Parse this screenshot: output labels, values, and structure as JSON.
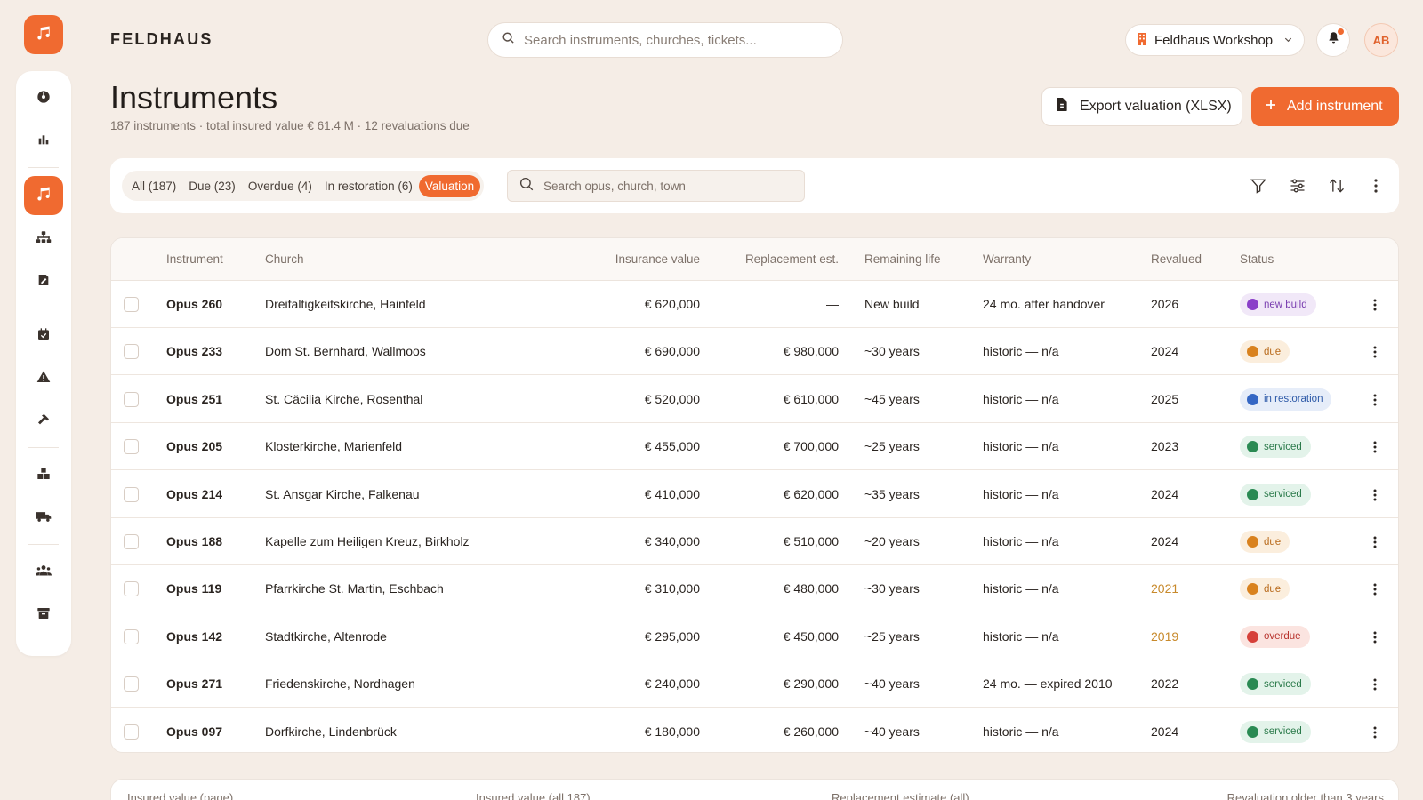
{
  "brand": "FELDHAUS",
  "search": {
    "placeholder": "Search instruments, churches, tickets..."
  },
  "workspace": {
    "label": "Feldhaus Workshop"
  },
  "user": {
    "initials": "AB"
  },
  "sidebar": {
    "items": [
      {
        "icon": "dashboard-icon"
      },
      {
        "icon": "bar-chart-icon"
      },
      {
        "icon": "music-note-icon",
        "active": true
      },
      {
        "icon": "org-chart-icon"
      },
      {
        "icon": "contract-icon"
      },
      {
        "icon": "calendar-icon"
      },
      {
        "icon": "warning-icon"
      },
      {
        "icon": "hammer-icon"
      },
      {
        "icon": "warehouse-icon"
      },
      {
        "icon": "truck-icon"
      },
      {
        "icon": "team-icon"
      },
      {
        "icon": "archive-icon"
      }
    ]
  },
  "page": {
    "title": "Instruments",
    "subtitle": "187 instruments · total insured value € 61.4 M · 12 revaluations due",
    "export_label": "Export valuation (XLSX)",
    "add_label": "Add instrument"
  },
  "filters": [
    {
      "label": "All (187)",
      "active": false
    },
    {
      "label": "Due (23)",
      "active": false
    },
    {
      "label": "Overdue (4)",
      "active": false
    },
    {
      "label": "In restoration (6)",
      "active": false
    },
    {
      "label": "Valuation",
      "active": true
    }
  ],
  "table_search": {
    "placeholder": "Search opus, church, town"
  },
  "table": {
    "headers": {
      "instrument": "Instrument",
      "church": "Church",
      "insurance": "Insurance value",
      "replacement": "Replacement est.",
      "life": "Remaining life",
      "warranty": "Warranty",
      "revalued": "Revalued",
      "status": "Status"
    },
    "rows": [
      {
        "instrument": "Opus 260",
        "church": "Dreifaltigkeitskirche, Hainfeld",
        "insurance": "€ 620,000",
        "replacement": "—",
        "life": "New build",
        "warranty": "24 mo. after handover",
        "revalued": "2026",
        "revalued_warn": false,
        "status": "new build",
        "status_kind": "new"
      },
      {
        "instrument": "Opus 233",
        "church": "Dom St. Bernhard, Wallmoos",
        "insurance": "€ 690,000",
        "replacement": "€ 980,000",
        "life": "~30 years",
        "warranty": "historic — n/a",
        "revalued": "2024",
        "revalued_warn": false,
        "status": "due",
        "status_kind": "due"
      },
      {
        "instrument": "Opus 251",
        "church": "St. Cäcilia Kirche, Rosenthal",
        "insurance": "€ 520,000",
        "replacement": "€ 610,000",
        "life": "~45 years",
        "warranty": "historic — n/a",
        "revalued": "2025",
        "revalued_warn": false,
        "status": "in restoration",
        "status_kind": "restoration"
      },
      {
        "instrument": "Opus 205",
        "church": "Klosterkirche, Marienfeld",
        "insurance": "€ 455,000",
        "replacement": "€ 700,000",
        "life": "~25 years",
        "warranty": "historic — n/a",
        "revalued": "2023",
        "revalued_warn": false,
        "status": "serviced",
        "status_kind": "serviced"
      },
      {
        "instrument": "Opus 214",
        "church": "St. Ansgar Kirche, Falkenau",
        "insurance": "€ 410,000",
        "replacement": "€ 620,000",
        "life": "~35 years",
        "warranty": "historic — n/a",
        "revalued": "2024",
        "revalued_warn": false,
        "status": "serviced",
        "status_kind": "serviced"
      },
      {
        "instrument": "Opus 188",
        "church": "Kapelle zum Heiligen Kreuz, Birkholz",
        "insurance": "€ 340,000",
        "replacement": "€ 510,000",
        "life": "~20 years",
        "warranty": "historic — n/a",
        "revalued": "2024",
        "revalued_warn": false,
        "status": "due",
        "status_kind": "due"
      },
      {
        "instrument": "Opus 119",
        "church": "Pfarrkirche St. Martin, Eschbach",
        "insurance": "€ 310,000",
        "replacement": "€ 480,000",
        "life": "~30 years",
        "warranty": "historic — n/a",
        "revalued": "2021",
        "revalued_warn": true,
        "status": "due",
        "status_kind": "due"
      },
      {
        "instrument": "Opus 142",
        "church": "Stadtkirche, Altenrode",
        "insurance": "€ 295,000",
        "replacement": "€ 450,000",
        "life": "~25 years",
        "warranty": "historic — n/a",
        "revalued": "2019",
        "revalued_warn": true,
        "status": "overdue",
        "status_kind": "overdue"
      },
      {
        "instrument": "Opus 271",
        "church": "Friedenskirche, Nordhagen",
        "insurance": "€ 240,000",
        "replacement": "€ 290,000",
        "life": "~40 years",
        "warranty": "24 mo. — expired 2010",
        "revalued": "2022",
        "revalued_warn": false,
        "status": "serviced",
        "status_kind": "serviced"
      },
      {
        "instrument": "Opus 097",
        "church": "Dorfkirche, Lindenbrück",
        "insurance": "€ 180,000",
        "replacement": "€ 260,000",
        "life": "~40 years",
        "warranty": "historic — n/a",
        "revalued": "2024",
        "revalued_warn": false,
        "status": "serviced",
        "status_kind": "serviced"
      }
    ]
  },
  "status_colors": {
    "new": {
      "bg": "#f1e8f8",
      "dot": "#8a3fc9",
      "text": "#7a3fb0"
    },
    "due": {
      "bg": "#fbeedd",
      "dot": "#d9821e",
      "text": "#b8691a"
    },
    "restoration": {
      "bg": "#e6edf9",
      "dot": "#3567c4",
      "text": "#2e5aa8"
    },
    "serviced": {
      "bg": "#e3f3ea",
      "dot": "#2a8a53",
      "text": "#2a7a4a"
    },
    "overdue": {
      "bg": "#fbe4e0",
      "dot": "#d6403a",
      "text": "#b8342e"
    }
  },
  "summary": {
    "labels": [
      "Insured value (page)",
      "Insured value (all 187)",
      "Replacement estimate (all)",
      "Revaluation older than 3 years"
    ]
  },
  "colors": {
    "accent": "#f06a30",
    "background": "#f5ede6"
  }
}
